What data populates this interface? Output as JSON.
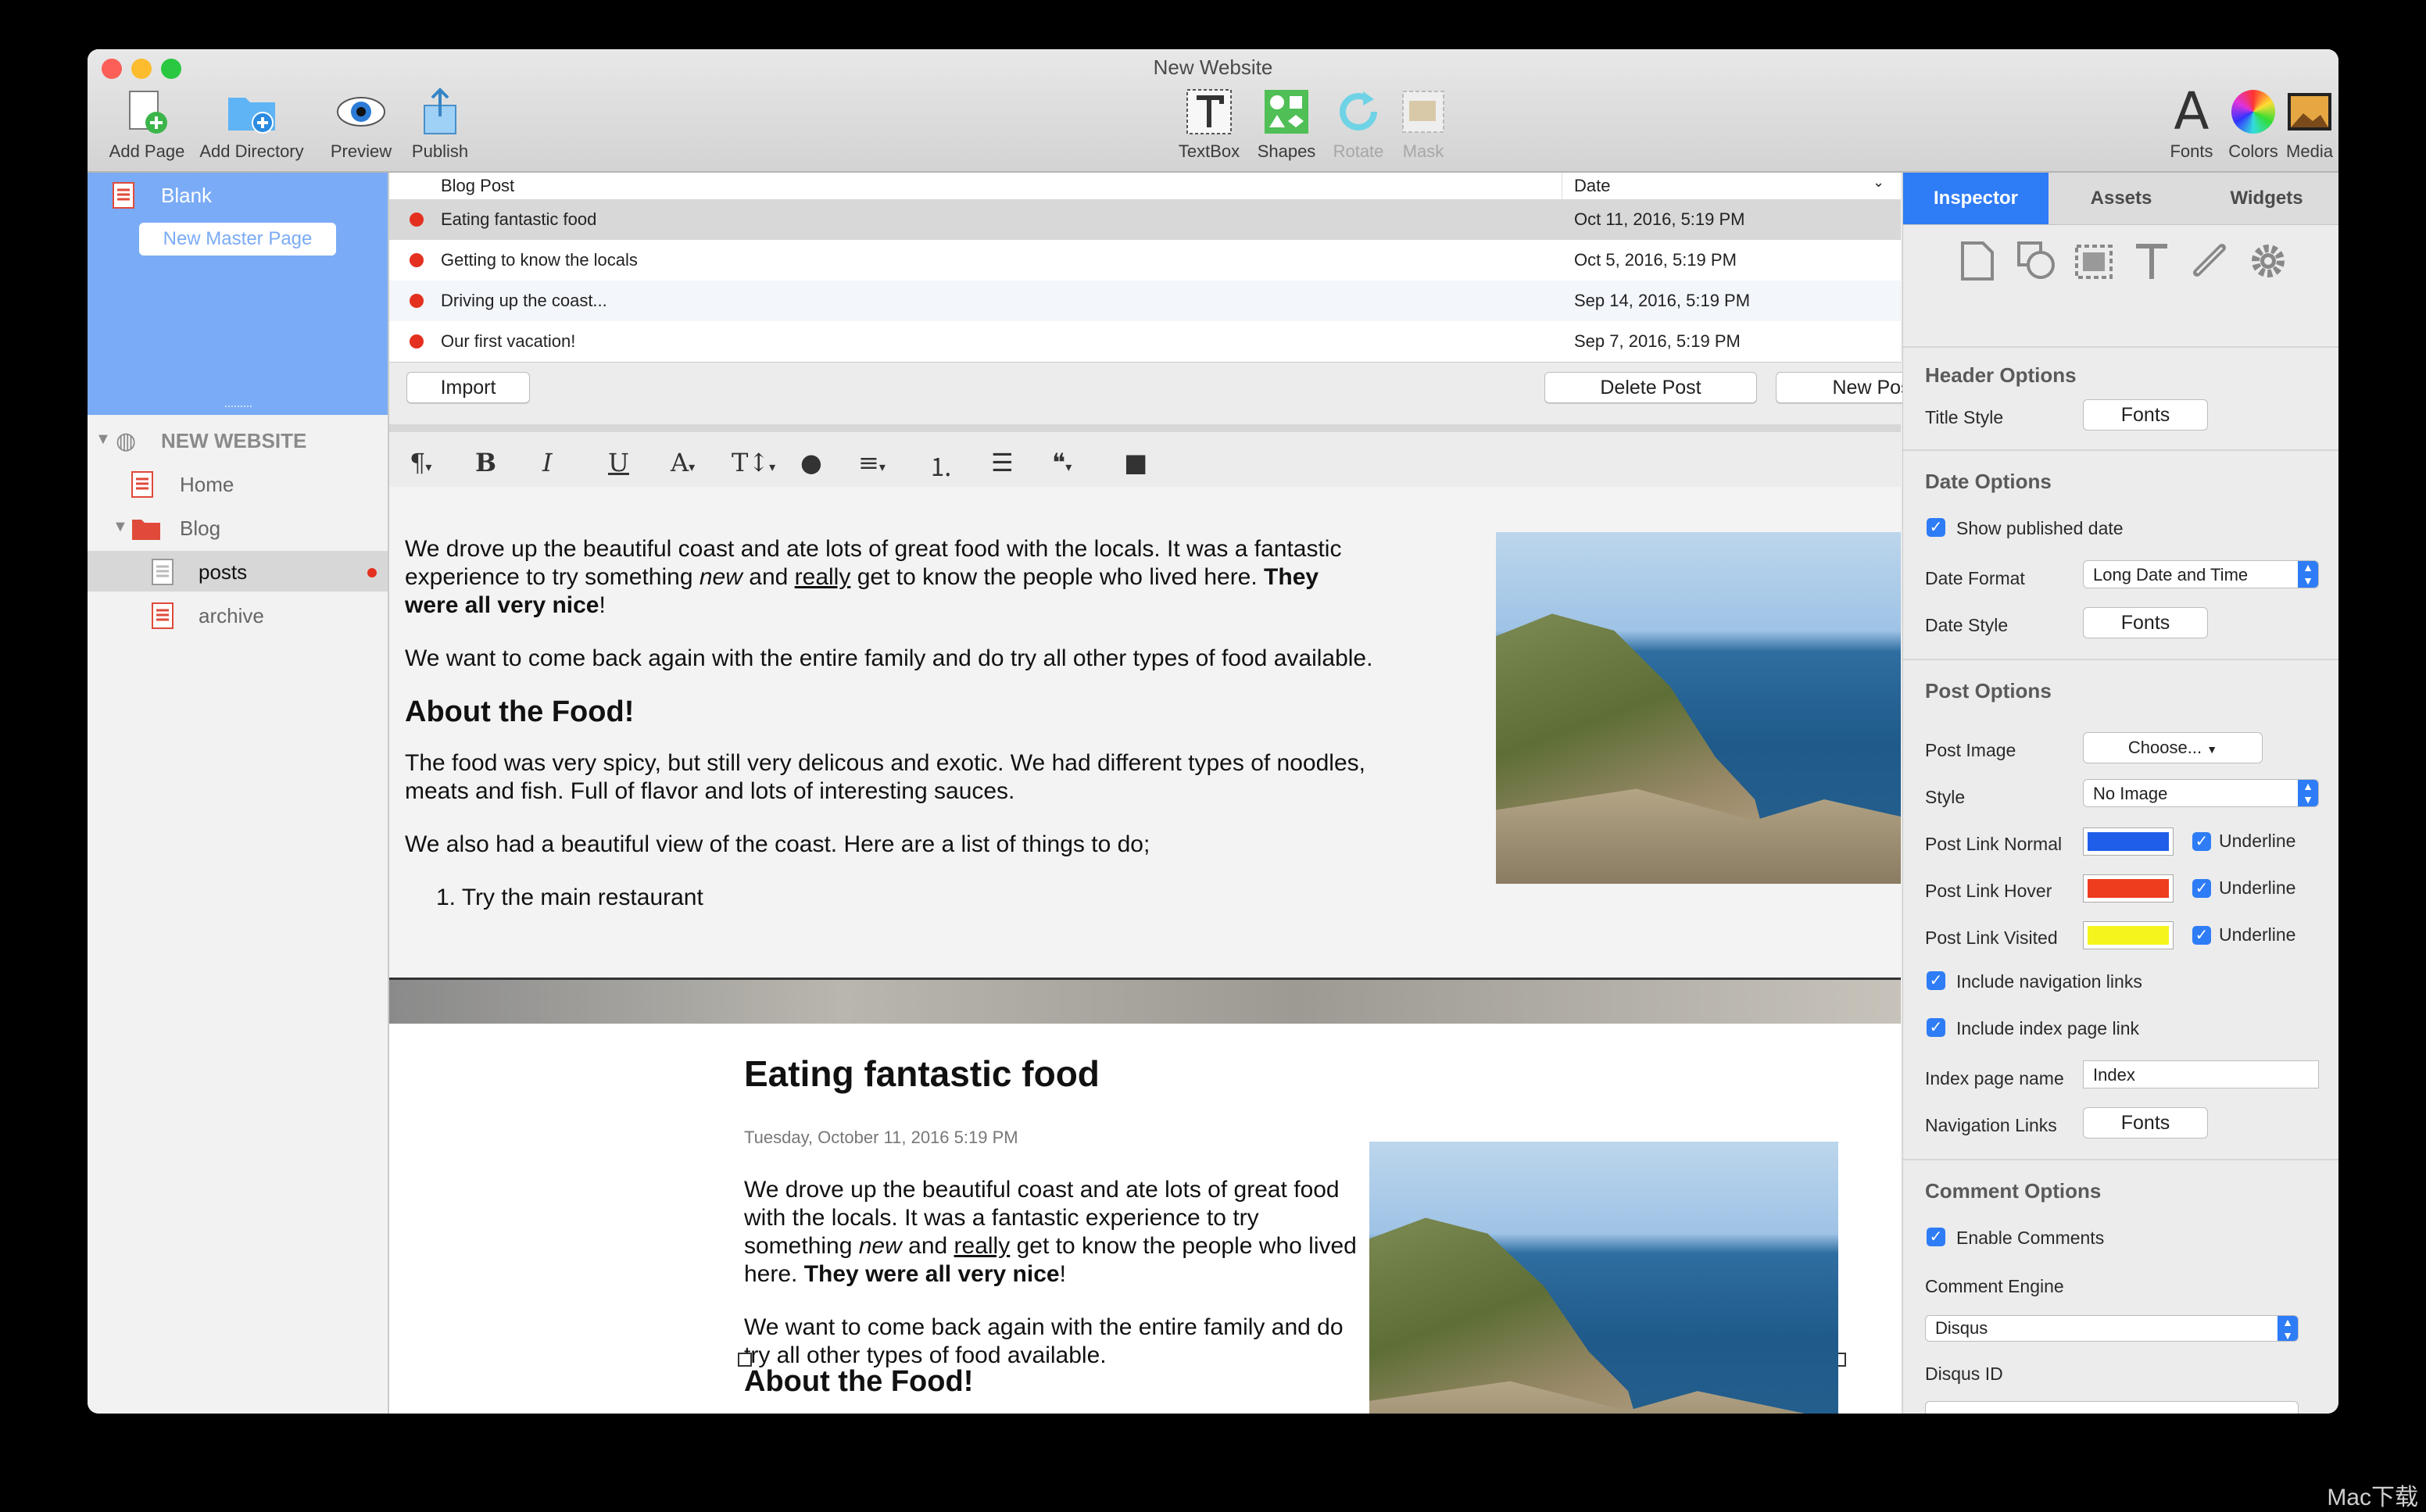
{
  "window": {
    "title": "New Website"
  },
  "toolbar": {
    "add_page": "Add Page",
    "add_directory": "Add Directory",
    "preview": "Preview",
    "publish": "Publish",
    "textbox": "TextBox",
    "shapes": "Shapes",
    "rotate": "Rotate",
    "mask": "Mask",
    "fonts": "Fonts",
    "colors": "Colors",
    "media": "Media"
  },
  "sidebar": {
    "master_item": "Blank",
    "new_master_button": "New Master Page",
    "site_name": "NEW WEBSITE",
    "items": [
      {
        "label": "Home"
      },
      {
        "label": "Blog"
      },
      {
        "label": "posts"
      },
      {
        "label": "archive"
      }
    ]
  },
  "posts": {
    "columns": [
      "Blog Post",
      "Date"
    ],
    "rows": [
      {
        "title": "Eating fantastic food",
        "date": "Oct 11, 2016, 5:19 PM"
      },
      {
        "title": "Getting to know the locals",
        "date": "Oct 5, 2016, 5:19 PM"
      },
      {
        "title": "Driving up the coast...",
        "date": "Sep 14, 2016, 5:19 PM"
      },
      {
        "title": "Our first vacation!",
        "date": "Sep 7, 2016, 5:19 PM"
      }
    ],
    "import_button": "Import",
    "delete_button": "Delete Post",
    "new_button": "New Post"
  },
  "editor": {
    "p1_a": "We drove up the beautiful coast and ate lots of great food with the locals. It was a fantastic experience to try something ",
    "p1_em": "new",
    "p1_b": " and ",
    "p1_u": "really",
    "p1_c": " get to know the people who lived here. ",
    "p1_strong": "They were all very nice",
    "p1_d": "!",
    "p2": "We want to come back again with the entire family and do try all other types of food available.",
    "h": "About the Food!",
    "p3": "The food was very spicy, but still very delicous and exotic. We had different types of noodles, meats and fish. Full of flavor and lots of interesting sauces.",
    "p4": "We also had a beautiful view of the coast. Here are a list of things to do;",
    "li1": "Try the main restaurant"
  },
  "preview": {
    "title": "Eating fantastic food",
    "date": "Tuesday, October 11, 2016 5:19 PM",
    "heading": "About the Food!"
  },
  "inspector": {
    "tabs": [
      "Inspector",
      "Assets",
      "Widgets"
    ],
    "header_options": "Header Options",
    "title_style": "Title Style",
    "fonts_btn": "Fonts",
    "date_options": "Date Options",
    "show_published": "Show published date",
    "date_format": "Date Format",
    "date_format_value": "Long Date and Time",
    "date_style": "Date Style",
    "post_options": "Post Options",
    "post_image": "Post Image",
    "choose": "Choose...",
    "style": "Style",
    "style_value": "No Image",
    "link_normal": "Post Link Normal",
    "link_hover": "Post Link Hover",
    "link_visited": "Post Link Visited",
    "underline": "Underline",
    "include_nav": "Include navigation links",
    "include_index": "Include index page link",
    "index_name": "Index page name",
    "index_value": "Index",
    "nav_links": "Navigation Links",
    "comment_options": "Comment Options",
    "enable_comments": "Enable Comments",
    "comment_engine": "Comment Engine",
    "engine_value": "Disqus",
    "disqus_id": "Disqus ID"
  },
  "colors": {
    "accent": "#2e7cf6",
    "master_bg": "#7aabf6",
    "link_normal": "#1f5ee8",
    "link_hover": "#ee3d1e",
    "link_visited": "#f5f51d",
    "status_dot": "#e4301f"
  },
  "watermark": "Mac下载"
}
